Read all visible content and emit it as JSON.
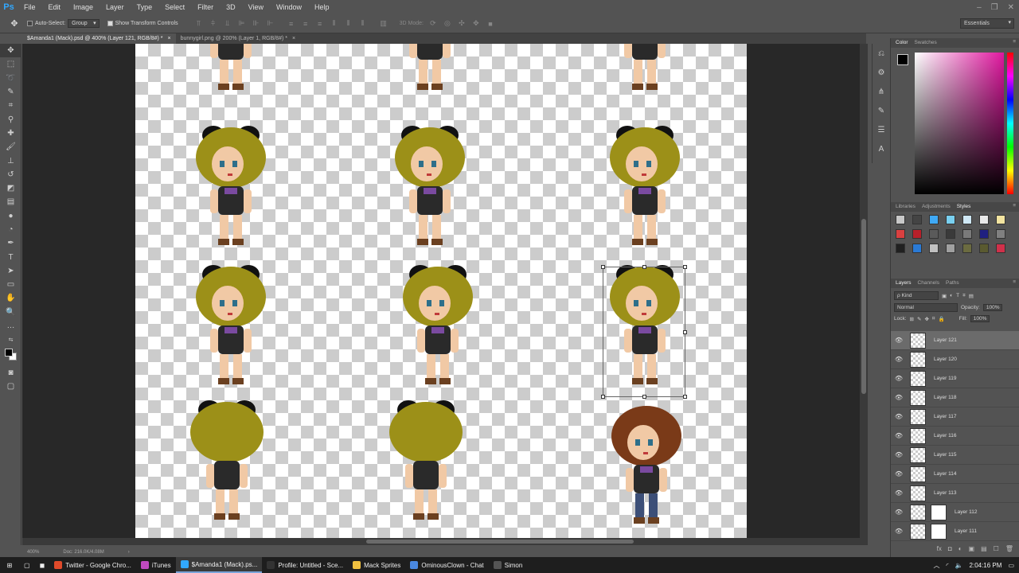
{
  "app": {
    "logo": "Ps"
  },
  "menu": [
    "File",
    "Edit",
    "Image",
    "Layer",
    "Type",
    "Select",
    "Filter",
    "3D",
    "View",
    "Window",
    "Help"
  ],
  "window_controls": [
    "–",
    "❐",
    "✕"
  ],
  "options": {
    "auto_select_label": "Auto-Select:",
    "auto_select_value": "Group",
    "transform_label": "Show Transform Controls",
    "mode_3d_label": "3D Mode:",
    "workspace": "Essentials"
  },
  "tabs": [
    {
      "label": "$Amanda1 (Mack).psd @ 400% (Layer 121, RGB/8#) *",
      "close": "×"
    },
    {
      "label": "bunnygirl.png @ 200% (Layer 1, RGB/8#) *",
      "close": "×"
    }
  ],
  "status": {
    "zoom": "400%",
    "doc": "Doc: 216.0K/4.08M",
    "arrow": "›"
  },
  "panels": {
    "color_tabs": [
      "Color",
      "Swatches"
    ],
    "style_tabs": [
      "Libraries",
      "Adjustments",
      "Styles"
    ],
    "layer_tabs": [
      "Layers",
      "Channels",
      "Paths"
    ],
    "panel_menu": "≡",
    "kind_label": "ρ Kind",
    "blend_mode": "Normal",
    "opacity_label": "Opacity:",
    "opacity_value": "100%",
    "lock_label": "Lock:",
    "fill_label": "Fill:",
    "fill_value": "100%"
  },
  "style_swatches": [
    "#c8c8c8",
    "#444444",
    "#3fa9f5",
    "#79d0f0",
    "#cfe8f5",
    "#e9e9e9",
    "#f3e4a0",
    "#d94040",
    "#b8202a",
    "#5a5a5a",
    "#3a3a3a",
    "#7a7a7a",
    "#202080",
    "#808080",
    "#202020",
    "#2a7ad5",
    "#c0c0c0",
    "#a0a0a0",
    "#6b6b40",
    "#5a5a30",
    "#d0304a"
  ],
  "layers": [
    {
      "name": "Layer 121",
      "selected": true,
      "mask": false
    },
    {
      "name": "Layer 120",
      "selected": false,
      "mask": false
    },
    {
      "name": "Layer 119",
      "selected": false,
      "mask": false
    },
    {
      "name": "Layer 118",
      "selected": false,
      "mask": false
    },
    {
      "name": "Layer 117",
      "selected": false,
      "mask": false
    },
    {
      "name": "Layer 116",
      "selected": false,
      "mask": false
    },
    {
      "name": "Layer 115",
      "selected": false,
      "mask": false
    },
    {
      "name": "Layer 114",
      "selected": false,
      "mask": false
    },
    {
      "name": "Layer 113",
      "selected": false,
      "mask": false
    },
    {
      "name": "Layer 112",
      "selected": false,
      "mask": true
    },
    {
      "name": "Layer 111",
      "selected": false,
      "mask": true
    }
  ],
  "layer_footer_icons": [
    "fx",
    "◘",
    "◐",
    "▣",
    "▤",
    "☐",
    "🗑"
  ],
  "taskbar": {
    "items": [
      {
        "label": "Twitter - Google Chro...",
        "color": "#e04a2a"
      },
      {
        "label": "iTunes",
        "color": "#c04ac0"
      },
      {
        "label": "$Amanda1 (Mack).ps...",
        "color": "#31a8ff",
        "active": true
      },
      {
        "label": "Profile: Untitled - Sce...",
        "color": "#333333"
      },
      {
        "label": "Mack Sprites",
        "color": "#f0c040"
      },
      {
        "label": "OminousClown - Chat",
        "color": "#4a88e0"
      },
      {
        "label": "Simon",
        "color": "#555555"
      }
    ],
    "clock": "2:04:16 PM"
  }
}
